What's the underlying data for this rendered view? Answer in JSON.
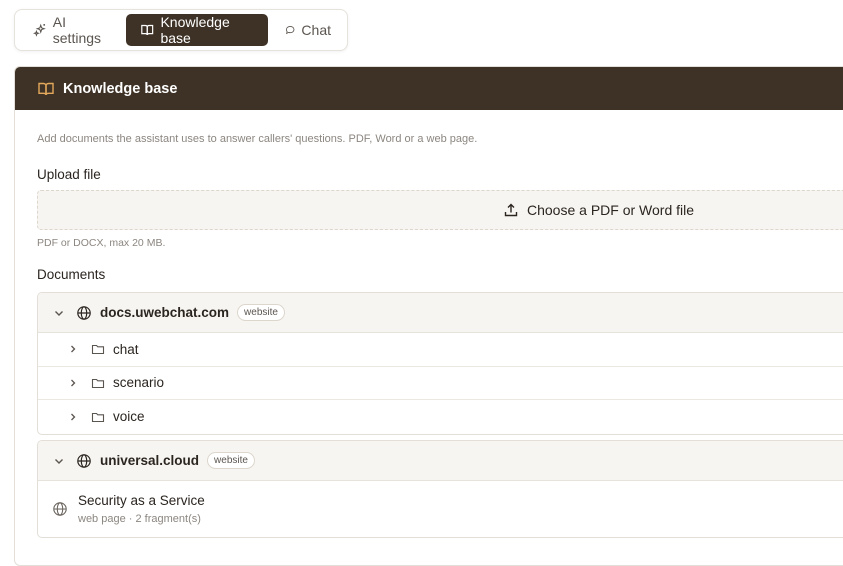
{
  "tabs": [
    {
      "label": "AI settings",
      "icon": "sparkles-icon",
      "active": false
    },
    {
      "label": "Knowledge base",
      "icon": "book-icon",
      "active": true
    },
    {
      "label": "Chat",
      "icon": "chat-bubble-icon",
      "active": false
    }
  ],
  "colors": {
    "brand_dark": "#3e3226",
    "accent": "#e3a85b",
    "surface": "#f7f5f1"
  },
  "card": {
    "title": "Knowledge base",
    "description": "Add documents the assistant uses to answer callers' questions. PDF, Word or a web page.",
    "upload_label": "Upload file",
    "upload_button": "Choose a PDF or Word file",
    "upload_hint": "PDF or DOCX, max 20 MB.",
    "documents_label": "Documents"
  },
  "documents": [
    {
      "name": "docs.uwebchat.com",
      "badge": "website",
      "folders": [
        "chat",
        "scenario",
        "voice"
      ]
    },
    {
      "name": "universal.cloud",
      "badge": "website",
      "pages": [
        {
          "title": "Security as a Service",
          "meta": "web page · 2 fragment(s)"
        }
      ]
    }
  ]
}
